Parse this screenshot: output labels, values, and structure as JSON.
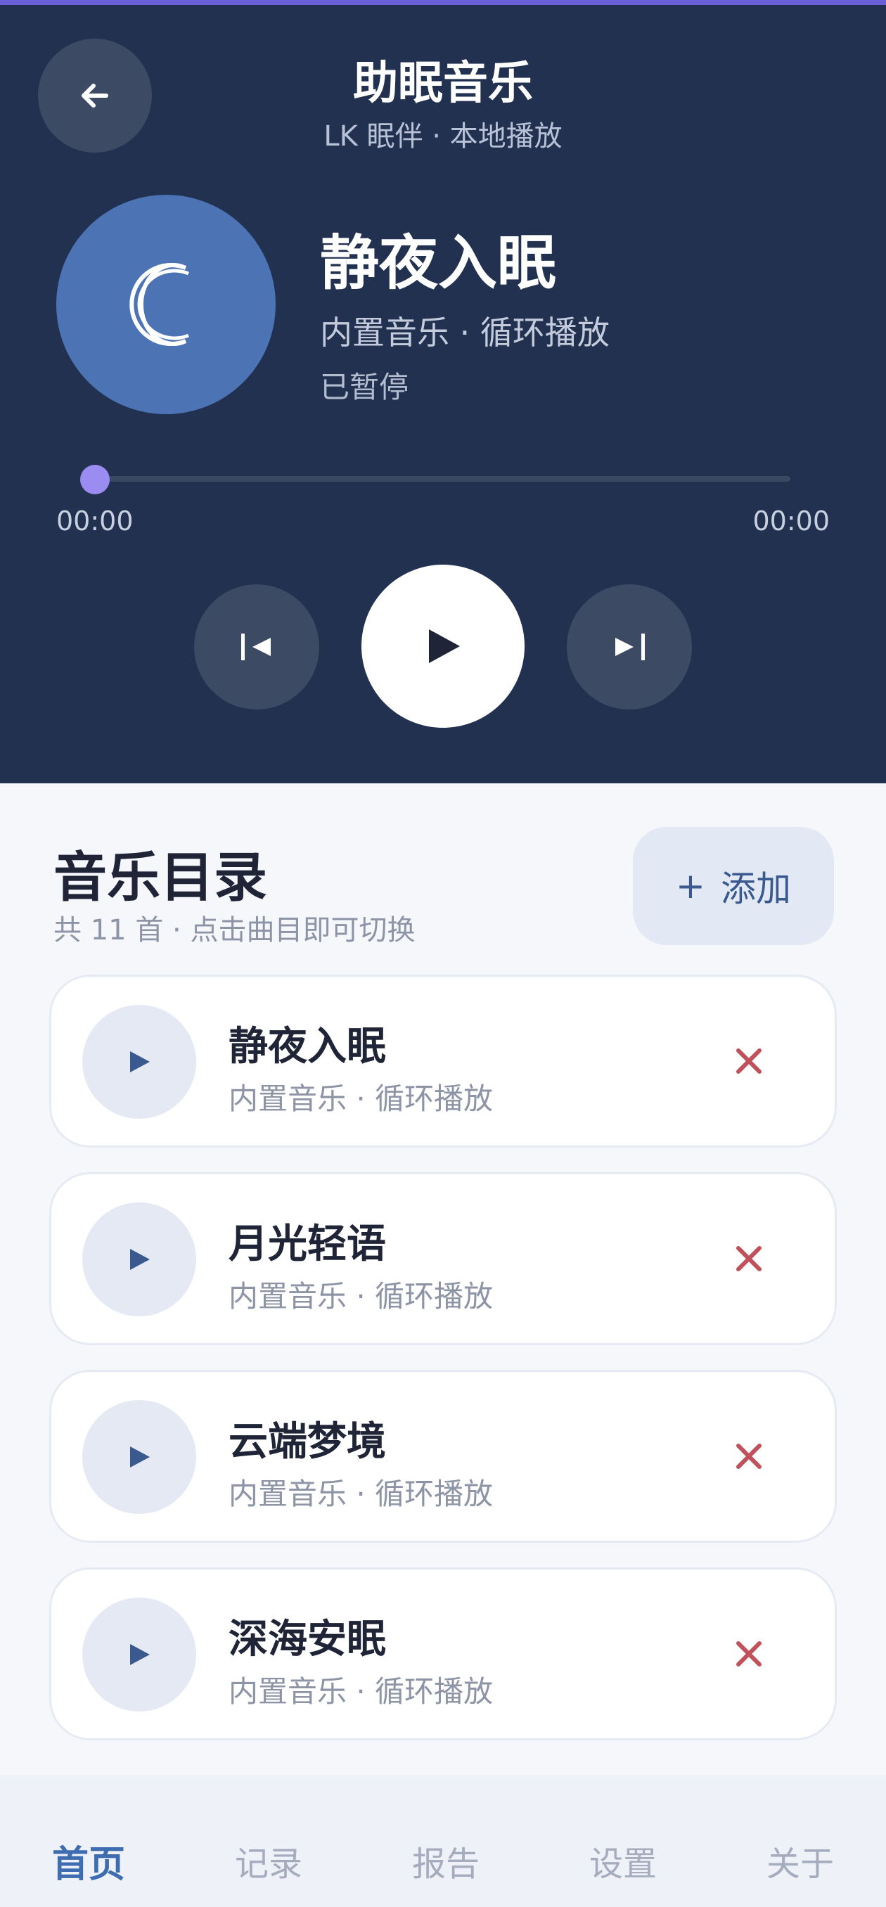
{
  "header": {
    "title": "助眠音乐",
    "subtitle": "LK 眠伴 · 本地播放",
    "back_icon": "arrow-left-icon"
  },
  "now_playing": {
    "title": "静夜入眠",
    "meta": "内置音乐 · 循环播放",
    "status": "已暂停",
    "album_icon": "crescent-moon-icon",
    "progress": 0,
    "time_current": "00:00",
    "time_total": "00:00"
  },
  "controls": {
    "prev_icon": "skip-previous-icon",
    "play_icon": "play-icon",
    "next_icon": "skip-next-icon"
  },
  "library": {
    "title": "音乐目录",
    "subtitle": "共 11 首 · 点击曲目即可切换",
    "add_label": "添加",
    "add_icon": "plus-icon",
    "tracks": [
      {
        "name": "静夜入眠",
        "meta": "内置音乐 · 循环播放"
      },
      {
        "name": "月光轻语",
        "meta": "内置音乐 · 循环播放"
      },
      {
        "name": "云端梦境",
        "meta": "内置音乐 · 循环播放"
      },
      {
        "name": "深海安眠",
        "meta": "内置音乐 · 循环播放"
      }
    ]
  },
  "nav": {
    "items": [
      "首页",
      "记录",
      "报告",
      "设置",
      "关于"
    ],
    "active": "首页"
  },
  "colors": {
    "header_bg": "#223150",
    "accent": "#6b5fd6",
    "progress_knob": "#9b8cf2",
    "album_bg": "#4c74b4",
    "remove": "#c0505a",
    "nav_active": "#3d6db0"
  }
}
